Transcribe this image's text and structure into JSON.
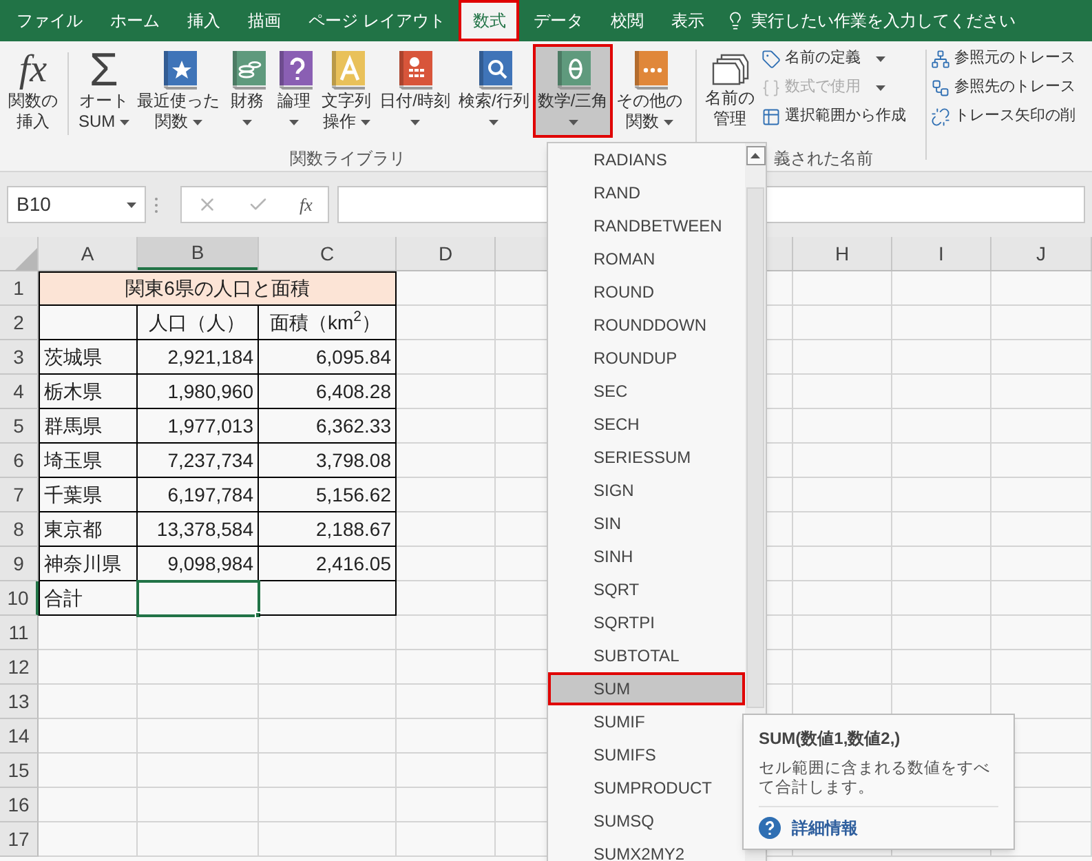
{
  "tabs": [
    {
      "label": "ファイル",
      "selected": false
    },
    {
      "label": "ホーム",
      "selected": false
    },
    {
      "label": "挿入",
      "selected": false
    },
    {
      "label": "描画",
      "selected": false
    },
    {
      "label": "ページ レイアウト",
      "selected": false
    },
    {
      "label": "数式",
      "selected": true
    },
    {
      "label": "データ",
      "selected": false
    },
    {
      "label": "校閲",
      "selected": false
    },
    {
      "label": "表示",
      "selected": false
    }
  ],
  "tell_me": {
    "placeholder": "実行したい作業を入力してください"
  },
  "ribbon": {
    "library": {
      "label": "関数ライブラリ",
      "buttons": [
        {
          "kind": "fx",
          "glyph": "fx",
          "lines": [
            "関数の",
            "挿入"
          ],
          "has_menu": false,
          "selected": false
        },
        {
          "kind": "sigma",
          "glyph": "Σ",
          "lines": [
            "オート",
            "SUM"
          ],
          "has_menu": true,
          "selected": false
        },
        {
          "kind": "recent",
          "lines": [
            "最近使った",
            "関数"
          ],
          "has_menu": true,
          "selected": false
        },
        {
          "kind": "financial",
          "lines": [
            "財務"
          ],
          "has_menu": true,
          "selected": false
        },
        {
          "kind": "logical",
          "lines": [
            "論理"
          ],
          "has_menu": true,
          "selected": false
        },
        {
          "kind": "text",
          "lines": [
            "文字列",
            "操作"
          ],
          "has_menu": true,
          "selected": false
        },
        {
          "kind": "datetime",
          "lines": [
            "日付/時刻"
          ],
          "has_menu": true,
          "selected": false
        },
        {
          "kind": "lookup",
          "lines": [
            "検索/行列"
          ],
          "has_menu": true,
          "selected": false
        },
        {
          "kind": "math",
          "lines": [
            "数学/三角"
          ],
          "has_menu": true,
          "selected": true
        },
        {
          "kind": "more",
          "lines": [
            "その他の",
            "関数"
          ],
          "has_menu": true,
          "selected": false
        }
      ]
    },
    "names": {
      "label": "義された名前",
      "manager": {
        "lines": [
          "名前の",
          "管理"
        ]
      },
      "items": [
        {
          "kind": "define",
          "label": "名前の定義",
          "has_menu": true,
          "disabled": false
        },
        {
          "kind": "use",
          "label": "数式で使用",
          "has_menu": true,
          "disabled": true
        },
        {
          "kind": "create",
          "label": "選択範囲から作成",
          "has_menu": false,
          "disabled": false
        }
      ]
    },
    "auditing": {
      "items": [
        {
          "kind": "precedents",
          "label": "参照元のトレース"
        },
        {
          "kind": "dependents",
          "label": "参照先のトレース"
        },
        {
          "kind": "remove",
          "label": "トレース矢印の削"
        }
      ]
    }
  },
  "formula_bar": {
    "name_box": "B10",
    "function_button": "fx"
  },
  "sheet": {
    "columns": [
      {
        "label": "A",
        "selected": false
      },
      {
        "label": "B",
        "selected": true
      },
      {
        "label": "C",
        "selected": false
      },
      {
        "label": "D",
        "selected": false
      },
      {
        "label": "H",
        "selected": false
      },
      {
        "label": "I",
        "selected": false
      },
      {
        "label": "J",
        "selected": false
      }
    ],
    "rows": [
      {
        "number": "1",
        "kind": "title",
        "selected": false,
        "title": "関東6県の人口と面積"
      },
      {
        "number": "2",
        "kind": "header",
        "selected": false,
        "cells": [
          {
            "selected": false
          },
          {
            "text": "人口（人）",
            "selected": false
          },
          {
            "text": "面積（km$^{2}$）",
            "selected": false
          }
        ]
      },
      {
        "number": "3",
        "kind": "data",
        "selected": false,
        "cells": [
          {
            "text": "茨城県",
            "selected": false
          },
          {
            "text": "2,921,184",
            "selected": false
          },
          {
            "text": "6,095.84",
            "selected": false
          }
        ]
      },
      {
        "number": "4",
        "kind": "data",
        "selected": false,
        "cells": [
          {
            "text": "栃木県",
            "selected": false
          },
          {
            "text": "1,980,960",
            "selected": false
          },
          {
            "text": "6,408.28",
            "selected": false
          }
        ]
      },
      {
        "number": "5",
        "kind": "data",
        "selected": false,
        "cells": [
          {
            "text": "群馬県",
            "selected": false
          },
          {
            "text": "1,977,013",
            "selected": false
          },
          {
            "text": "6,362.33",
            "selected": false
          }
        ]
      },
      {
        "number": "6",
        "kind": "data",
        "selected": false,
        "cells": [
          {
            "text": "埼玉県",
            "selected": false
          },
          {
            "text": "7,237,734",
            "selected": false
          },
          {
            "text": "3,798.08",
            "selected": false
          }
        ]
      },
      {
        "number": "7",
        "kind": "data",
        "selected": false,
        "cells": [
          {
            "text": "千葉県",
            "selected": false
          },
          {
            "text": "6,197,784",
            "selected": false
          },
          {
            "text": "5,156.62",
            "selected": false
          }
        ]
      },
      {
        "number": "8",
        "kind": "data",
        "selected": false,
        "cells": [
          {
            "text": "東京都",
            "selected": false
          },
          {
            "text": "13,378,584",
            "selected": false
          },
          {
            "text": "2,188.67",
            "selected": false
          }
        ]
      },
      {
        "number": "9",
        "kind": "data",
        "selected": false,
        "cells": [
          {
            "text": "神奈川県",
            "selected": false
          },
          {
            "text": "9,098,984",
            "selected": false
          },
          {
            "text": "2,416.05",
            "selected": false
          }
        ]
      },
      {
        "number": "10",
        "kind": "data",
        "selected": true,
        "cells": [
          {
            "text": "合計",
            "selected": false
          },
          {
            "selected": true
          },
          {
            "selected": false
          }
        ]
      },
      {
        "number": "11",
        "kind": "empty",
        "selected": false
      },
      {
        "number": "12",
        "kind": "empty",
        "selected": false
      },
      {
        "number": "13",
        "kind": "empty",
        "selected": false
      },
      {
        "number": "14",
        "kind": "empty",
        "selected": false
      },
      {
        "number": "15",
        "kind": "empty",
        "selected": false
      },
      {
        "number": "16",
        "kind": "empty",
        "selected": false
      },
      {
        "number": "17",
        "kind": "empty",
        "selected": false
      }
    ]
  },
  "function_menu": {
    "items": [
      {
        "label": "RADIANS",
        "selected": false
      },
      {
        "label": "RAND",
        "selected": false
      },
      {
        "label": "RANDBETWEEN",
        "selected": false
      },
      {
        "label": "ROMAN",
        "selected": false
      },
      {
        "label": "ROUND",
        "selected": false
      },
      {
        "label": "ROUNDDOWN",
        "selected": false
      },
      {
        "label": "ROUNDUP",
        "selected": false
      },
      {
        "label": "SEC",
        "selected": false
      },
      {
        "label": "SECH",
        "selected": false
      },
      {
        "label": "SERIESSUM",
        "selected": false
      },
      {
        "label": "SIGN",
        "selected": false
      },
      {
        "label": "SIN",
        "selected": false
      },
      {
        "label": "SINH",
        "selected": false
      },
      {
        "label": "SQRT",
        "selected": false
      },
      {
        "label": "SQRTPI",
        "selected": false
      },
      {
        "label": "SUBTOTAL",
        "selected": false
      },
      {
        "label": "SUM",
        "selected": true
      },
      {
        "label": "SUMIF",
        "selected": false
      },
      {
        "label": "SUMIFS",
        "selected": false
      },
      {
        "label": "SUMPRODUCT",
        "selected": false
      },
      {
        "label": "SUMSQ",
        "selected": false
      },
      {
        "label": "SUMX2MY2",
        "selected": false
      }
    ]
  },
  "tooltip": {
    "title": "SUM(数値1,数値2,)",
    "description": "セル範囲に含まれる数値をすべて合計します。",
    "link": "詳細情報"
  }
}
